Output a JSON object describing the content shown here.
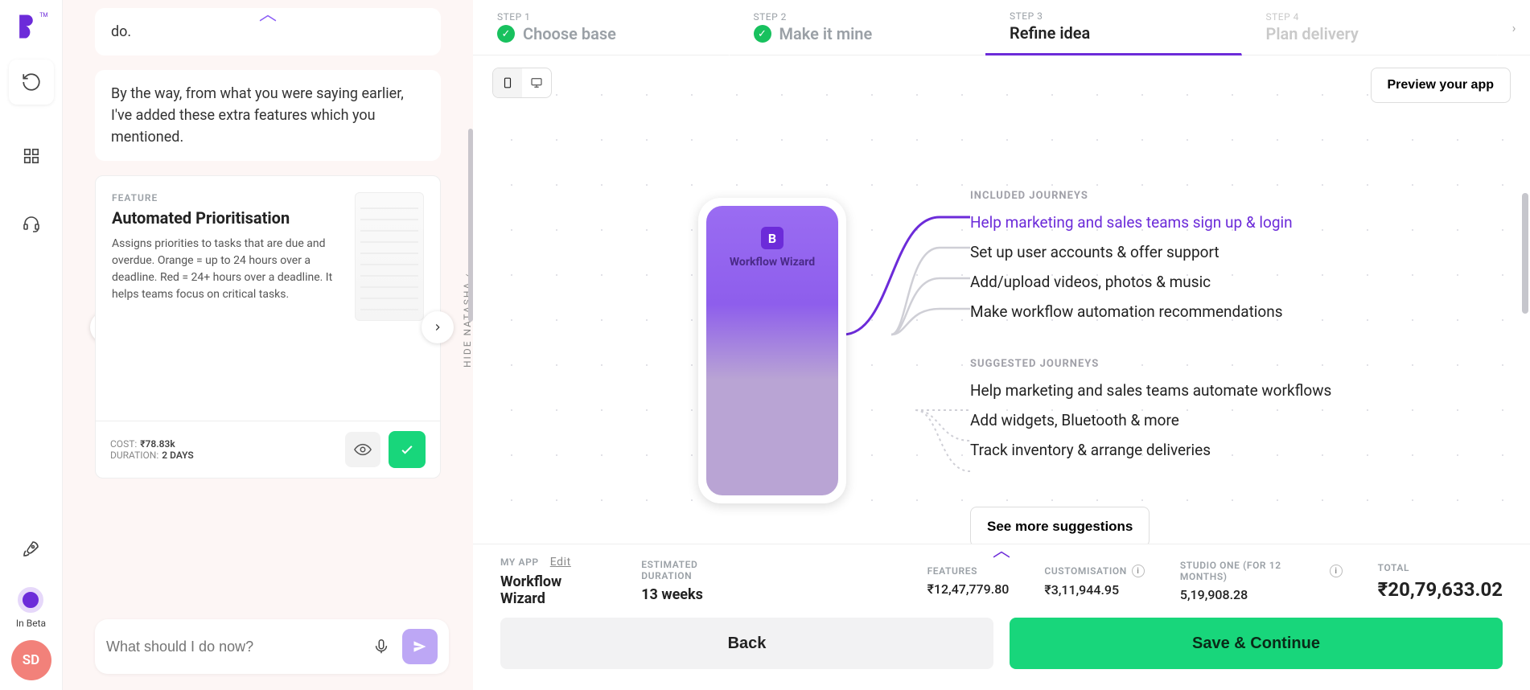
{
  "rail": {
    "beta_label": "In Beta",
    "avatar_initials": "SD"
  },
  "chat": {
    "bubble1": "do.",
    "bubble2": "By the way, from what you were saying earlier, I've added these extra features which you mentioned.",
    "feature": {
      "label": "FEATURE",
      "title": "Automated Prioritisation",
      "desc": "Assigns priorities to tasks that are due and overdue. Orange = up to 24 hours over a deadline. Red = 24+ hours over a deadline. It helps teams focus on critical tasks.",
      "cost_label": "COST:",
      "cost_value": "₹78.83k",
      "duration_label": "DURATION:",
      "duration_value": "2 DAYS"
    },
    "input_placeholder": "What should I do now?",
    "hide_label": "HIDE NATASHA"
  },
  "steps": [
    {
      "num": "STEP 1",
      "title": "Choose base",
      "done": true
    },
    {
      "num": "STEP 2",
      "title": "Make it mine",
      "done": true
    },
    {
      "num": "STEP 3",
      "title": "Refine idea",
      "active": true
    },
    {
      "num": "STEP 4",
      "title": "Plan delivery",
      "future": true
    }
  ],
  "canvas": {
    "preview_button": "Preview your app",
    "phone_app_name": "Workflow Wizard",
    "included_label": "INCLUDED JOURNEYS",
    "included": [
      "Help marketing and sales teams sign up & login",
      "Set up user accounts & offer support",
      "Add/upload videos, photos & music",
      "Make workflow automation recommendations"
    ],
    "suggested_label": "SUGGESTED JOURNEYS",
    "suggested": [
      "Help marketing and sales teams automate workflows",
      "Add widgets, Bluetooth & more",
      "Track inventory & arrange deliveries"
    ],
    "see_more": "See more suggestions"
  },
  "summary": {
    "myapp_label": "MY APP",
    "edit": "Edit",
    "myapp_value": "Workflow Wizard",
    "duration_label": "ESTIMATED DURATION",
    "duration_value": "13 weeks",
    "features_label": "FEATURES",
    "features_value": "₹12,47,779.80",
    "customisation_label": "CUSTOMISATION",
    "customisation_value": "₹3,11,944.95",
    "studio_label": "STUDIO ONE (FOR 12 MONTHS)",
    "studio_value": "5,19,908.28",
    "total_label": "TOTAL",
    "total_value": "₹20,79,633.02"
  },
  "actions": {
    "back": "Back",
    "save": "Save & Continue"
  }
}
